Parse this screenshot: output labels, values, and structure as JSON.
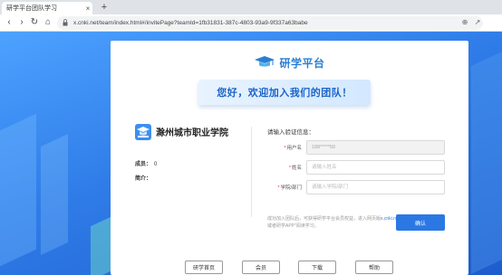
{
  "browser": {
    "tab_title": "研学平台团队学习",
    "tab_close": "×",
    "new_tab": "+",
    "url": "x.cnki.net/team/index.html#/invitePage?teamId=1fb31831-387c-4803-93a9-9f337a63babe",
    "icons": [
      "back-icon",
      "forward-icon",
      "reload-icon",
      "home-icon",
      "lock-icon",
      "zoom-icon",
      "share-icon"
    ]
  },
  "header": {
    "brand": "研学平台",
    "welcome": "您好，欢迎加入我们的团队！"
  },
  "team": {
    "name": "滁州城市职业学院",
    "members_label": "成员：",
    "members_count": "0",
    "intro_label": "简介："
  },
  "form": {
    "title": "请输入验证信息：",
    "username_label": "用户名",
    "username_value": "188*****58",
    "name_label": "姓名",
    "name_placeholder": "请输入姓名",
    "dept_label": "学院/部门",
    "dept_placeholder": "请输入学院/部门",
    "note_text": "成功加入团队后，可获得研学平台会员权益，进入网页版",
    "note_link": "x.cnki.net",
    "note_text2": "或者研学APP\"阅读学习。",
    "confirm_label": "确认"
  },
  "footer": {
    "buttons": [
      "研学首页",
      "会员",
      "下载",
      "帮助"
    ]
  },
  "colors": {
    "accent": "#2b78e4",
    "brand": "#2a7fd4",
    "background": "#2f7ce8"
  }
}
